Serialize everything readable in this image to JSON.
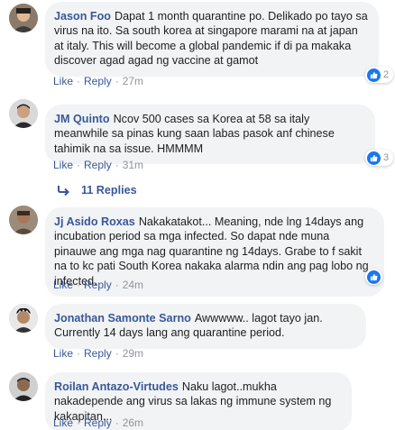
{
  "comments": [
    {
      "author": "Jason Foo",
      "text": "Dapat 1 month quarantine po. Delikado po tayo sa virus na ito. Sa south korea at singapore marami na at japan at italy. This will become a global pandemic if di pa makaka discover agad agad ng vaccine at gamot",
      "like_label": "Like",
      "reply_label": "Reply",
      "time": "27m",
      "reactions": "2"
    },
    {
      "author": "JM Quinto",
      "text": "Ncov 500 cases sa Korea at 58 sa italy meanwhile sa pinas kung saan labas pasok anf chinese tahimik na sa issue. HMMMM",
      "like_label": "Like",
      "reply_label": "Reply",
      "time": "31m",
      "reactions": "3",
      "replies_label": "11 Replies"
    },
    {
      "author": "Jj Asido Roxas",
      "text": "Nakakatakot... Meaning, nde lng 14days ang incubation period sa mga infected. So dapat nde muna pinauwe ang mga nag quarantine ng 14days. Grabe to f sakit na to kc pati South Korea nakaka alarma ndin ang pag lobo ng infected.",
      "like_label": "Like",
      "reply_label": "Reply",
      "time": "24m",
      "reactions": ""
    },
    {
      "author": "Jonathan Samonte Sarno",
      "text": "Awwwww.. lagot tayo jan. Currently 14 days lang ang quarantine period.",
      "like_label": "Like",
      "reply_label": "Reply",
      "time": "29m"
    },
    {
      "author": "Roilan Antazo-Virtudes",
      "text": "Naku lagot..mukha nakadepende ang virus sa lakas ng immune system ng kakapitan...",
      "like_label": "Like",
      "reply_label": "Reply",
      "time": "26m"
    }
  ],
  "colors": {
    "author": "#385898",
    "bubble": "#f2f3f5",
    "meta": "#90949c",
    "like": "#1877f2"
  },
  "icons": [
    "avatar",
    "like-icon",
    "reply-arrow-icon"
  ]
}
